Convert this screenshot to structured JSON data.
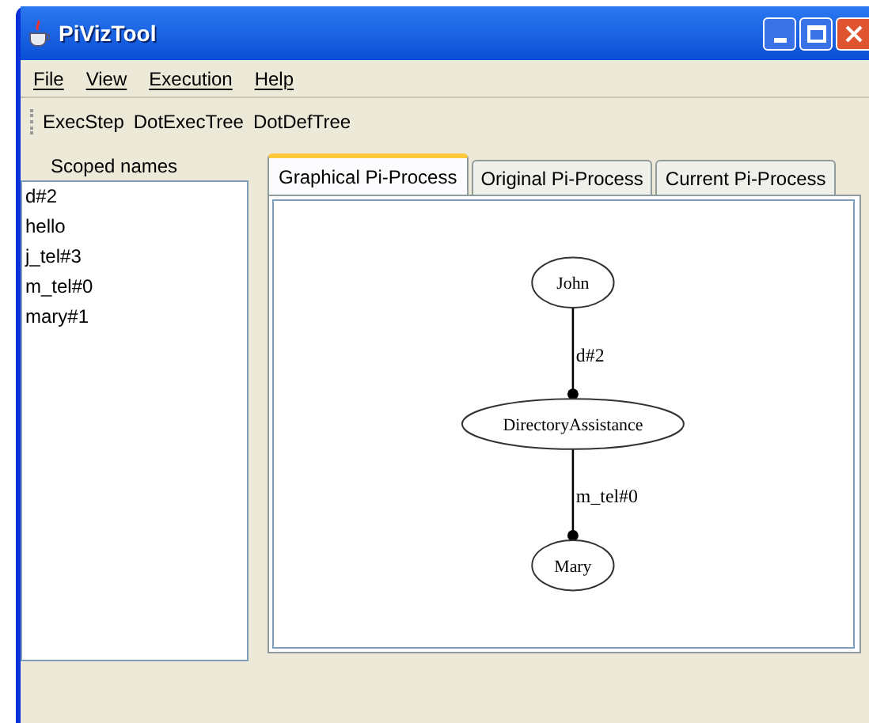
{
  "window": {
    "title": "PiVizTool"
  },
  "menu": [
    "File",
    "View",
    "Execution",
    "Help"
  ],
  "toolbar": [
    "ExecStep",
    "DotExecTree",
    "DotDefTree"
  ],
  "scoped_names": {
    "title": "Scoped names",
    "items": [
      "d#2",
      "hello",
      "j_tel#3",
      "m_tel#0",
      "mary#1"
    ]
  },
  "tabs": [
    {
      "label": "Graphical Pi-Process",
      "selected": true
    },
    {
      "label": "Original Pi-Process",
      "selected": false
    },
    {
      "label": "Current Pi-Process",
      "selected": false
    }
  ],
  "graph": {
    "nodes": [
      "John",
      "DirectoryAssistance",
      "Mary"
    ],
    "edges": [
      {
        "label": "d#2"
      },
      {
        "label": "m_tel#0"
      }
    ]
  }
}
